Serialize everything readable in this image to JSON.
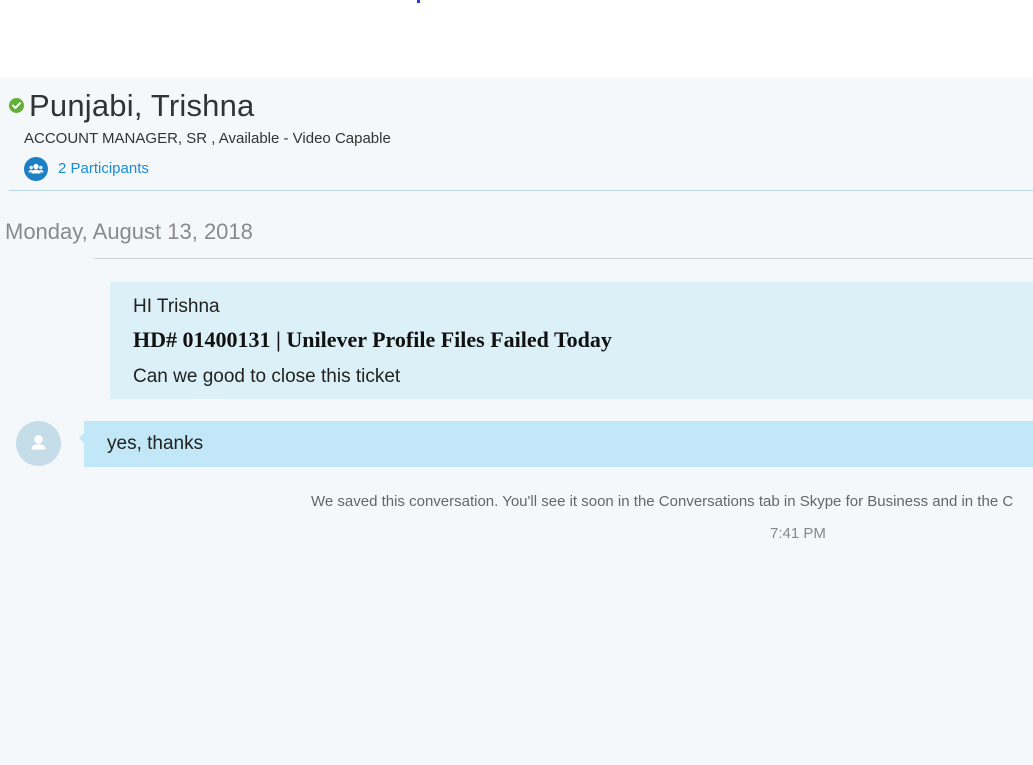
{
  "contact": {
    "name": "Punjabi, Trishna",
    "status": "ACCOUNT MANAGER, SR , Available - Video Capable",
    "presence_color": "#62b036"
  },
  "participants": {
    "label": "2 Participants",
    "icon": "people-icon"
  },
  "conversation": {
    "date": "Monday, August 13, 2018",
    "messages": [
      {
        "direction": "incoming",
        "greeting": "HI Trishna",
        "subject": "HD# 01400131 | Unilever Profile Files Failed Today",
        "body": "Can we good to close this ticket"
      },
      {
        "direction": "outgoing",
        "body": "yes, thanks"
      }
    ],
    "saved_notice": "We saved this conversation. You'll see it soon in the Conversations tab in Skype for Business and in the C",
    "timestamp": "7:41 PM"
  },
  "colors": {
    "incoming_bubble": "#dcf0f8",
    "outgoing_bubble": "#c2e7f6",
    "link": "#1c8ad6",
    "background": "#f4f8fb"
  }
}
